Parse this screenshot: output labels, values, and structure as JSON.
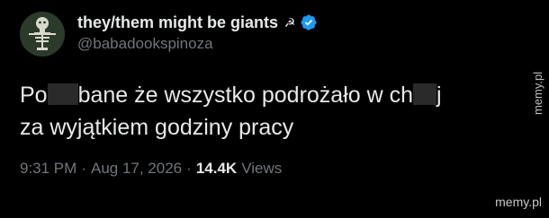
{
  "tweet": {
    "display_name": "they/them might be giants",
    "name_emoji": "☭",
    "verified": true,
    "handle": "@babadookspinoza",
    "text_part1": "Po",
    "text_part2": "bane że wszystko podrożało w ch",
    "text_part3": "j",
    "text_line2": "za wyjątkiem godziny pracy",
    "time": "9:31 PM",
    "date": "Aug 17, 2026",
    "views_count": "14.4K",
    "views_label": "Views",
    "separator": "·"
  },
  "watermark": {
    "vertical": "memy.pl",
    "bottom": "memy.pl"
  },
  "colors": {
    "background": "#000000",
    "text": "#e7e9ea",
    "secondary": "#71767b",
    "verified": "#1d9bf0"
  }
}
